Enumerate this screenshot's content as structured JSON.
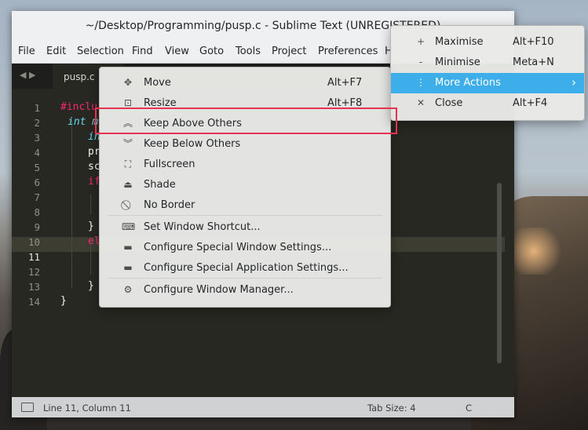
{
  "window": {
    "title": "~/Desktop/Programming/pusp.c - Sublime Text (UNREGISTERED)",
    "menubar": [
      "File",
      "Edit",
      "Selection",
      "Find",
      "View",
      "Goto",
      "Tools",
      "Project",
      "Preferences",
      "H"
    ],
    "tab": {
      "label": "pusp.c"
    },
    "line_numbers": [
      "1",
      "2",
      "3",
      "4",
      "5",
      "6",
      "7",
      "8",
      "9",
      "10",
      "11",
      "12",
      "13",
      "14"
    ],
    "current_line": "11",
    "code_lines": [
      {
        "text": "#inclu",
        "cls": "kw-pink"
      },
      {
        "text": "int m",
        "cls": "kw-blue"
      },
      {
        "text": "in",
        "cls": "kw-blue"
      },
      {
        "text": "pr",
        "cls": "plain"
      },
      {
        "text": "sc",
        "cls": "plain"
      },
      {
        "text": "if",
        "cls": "kw-pink"
      },
      {
        "text": "",
        "cls": "plain"
      },
      {
        "text": "",
        "cls": "plain"
      },
      {
        "text": "}",
        "cls": "plain"
      },
      {
        "text": "el",
        "cls": "kw-pink"
      },
      {
        "text": "",
        "cls": "plain"
      },
      {
        "text": "",
        "cls": "plain"
      },
      {
        "text": "}",
        "cls": "plain"
      },
      {
        "text": "}",
        "cls": "plain"
      }
    ],
    "status": {
      "position": "Line 11, Column 11",
      "tab_size": "Tab Size: 4",
      "syntax": "C"
    }
  },
  "context_menu": {
    "items": [
      {
        "icon": "move-icon",
        "glyph": "✥",
        "label": "Move",
        "shortcut": "Alt+F7"
      },
      {
        "icon": "resize-icon",
        "glyph": "⊡",
        "label": "Resize",
        "shortcut": "Alt+F8"
      },
      {
        "icon": "keep-above-icon",
        "glyph": "︽",
        "label": "Keep Above Others",
        "shortcut": ""
      },
      {
        "icon": "keep-below-icon",
        "glyph": "︾",
        "label": "Keep Below Others",
        "shortcut": ""
      },
      {
        "icon": "fullscreen-icon",
        "glyph": "⛶",
        "label": "Fullscreen",
        "shortcut": ""
      },
      {
        "icon": "shade-icon",
        "glyph": "⏏",
        "label": "Shade",
        "shortcut": ""
      },
      {
        "icon": "no-border-icon",
        "glyph": "⃠",
        "label": "No Border",
        "shortcut": ""
      },
      {
        "icon": "keyboard-icon",
        "glyph": "⌨",
        "label": "Set Window Shortcut...",
        "shortcut": ""
      },
      {
        "icon": "window-settings-icon",
        "glyph": "▬",
        "label": "Configure Special Window Settings...",
        "shortcut": ""
      },
      {
        "icon": "application-settings-icon",
        "glyph": "▬",
        "label": "Configure Special Application Settings...",
        "shortcut": ""
      },
      {
        "icon": "gear-icon",
        "glyph": "⚙",
        "label": "Configure Window Manager...",
        "shortcut": ""
      }
    ]
  },
  "submenu": {
    "items": [
      {
        "icon": "plus-icon",
        "glyph": "+",
        "label": "Maximise",
        "shortcut": "Alt+F10"
      },
      {
        "icon": "minus-icon",
        "glyph": "-",
        "label": "Minimise",
        "shortcut": "Meta+N"
      },
      {
        "icon": "more-icon",
        "glyph": "⋮",
        "label": "More Actions",
        "shortcut": ""
      },
      {
        "icon": "close-icon",
        "glyph": "✕",
        "label": "Close",
        "shortcut": "Alt+F4"
      }
    ],
    "arrow": "›"
  },
  "colors": {
    "accent": "#3daee9",
    "highlight_box": "#e8324f",
    "editor_bg": "#272822"
  }
}
